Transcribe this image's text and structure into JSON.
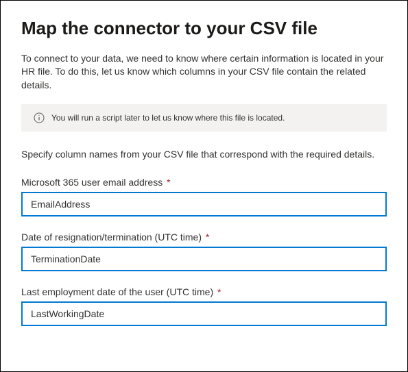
{
  "title": "Map the connector to your CSV file",
  "intro": "To connect to your data, we need to know where certain information is located in your HR file. To do this, let us know which columns in your CSV file contain the related details.",
  "info_banner": {
    "text": "You will run a script later to let us know where this file is located."
  },
  "specify_text": "Specify column names from your CSV file that correspond with the required details.",
  "fields": [
    {
      "label": "Microsoft 365 user email address",
      "required": true,
      "value": "EmailAddress"
    },
    {
      "label": "Date of resignation/termination (UTC time)",
      "required": true,
      "value": "TerminationDate"
    },
    {
      "label": "Last employment date of the user (UTC time)",
      "required": true,
      "value": "LastWorkingDate"
    }
  ],
  "required_marker": "*"
}
